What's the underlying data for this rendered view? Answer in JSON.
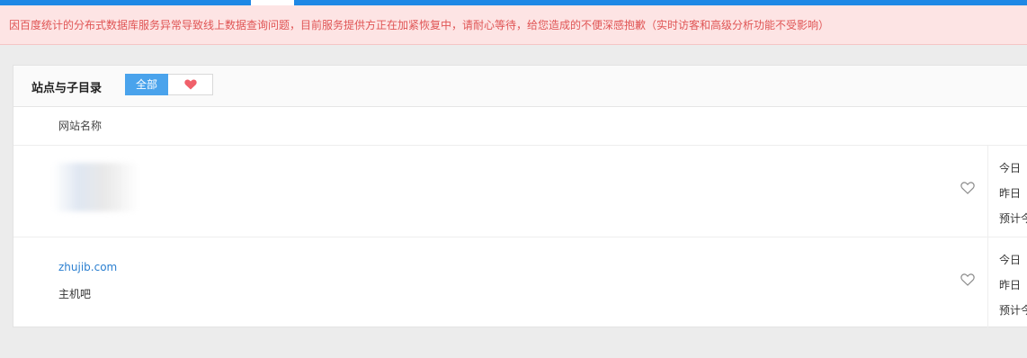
{
  "alert": {
    "text": "因百度统计的分布式数据库服务异常导致线上数据查询问题，目前服务提供方正在加紧恢复中，请耐心等待，给您造成的不便深感抱歉（实时访客和高级分析功能不受影响）"
  },
  "panel": {
    "title": "站点与子目录",
    "filter": {
      "all_label": "全部",
      "fav_icon": "heart-icon"
    },
    "column_header": "网站名称"
  },
  "rows": [
    {
      "url": "",
      "name": "",
      "stats": [
        "今日",
        "昨日",
        "预计今"
      ]
    },
    {
      "url": "zhujib.com",
      "name": "主机吧",
      "stats": [
        "今日",
        "昨日",
        "预计今"
      ]
    }
  ],
  "colors": {
    "accent": "#4aa3ec",
    "alert_bg": "#fde4e4",
    "alert_text": "#e05555",
    "heart": "#f0606a",
    "link": "#2b7fd0"
  }
}
